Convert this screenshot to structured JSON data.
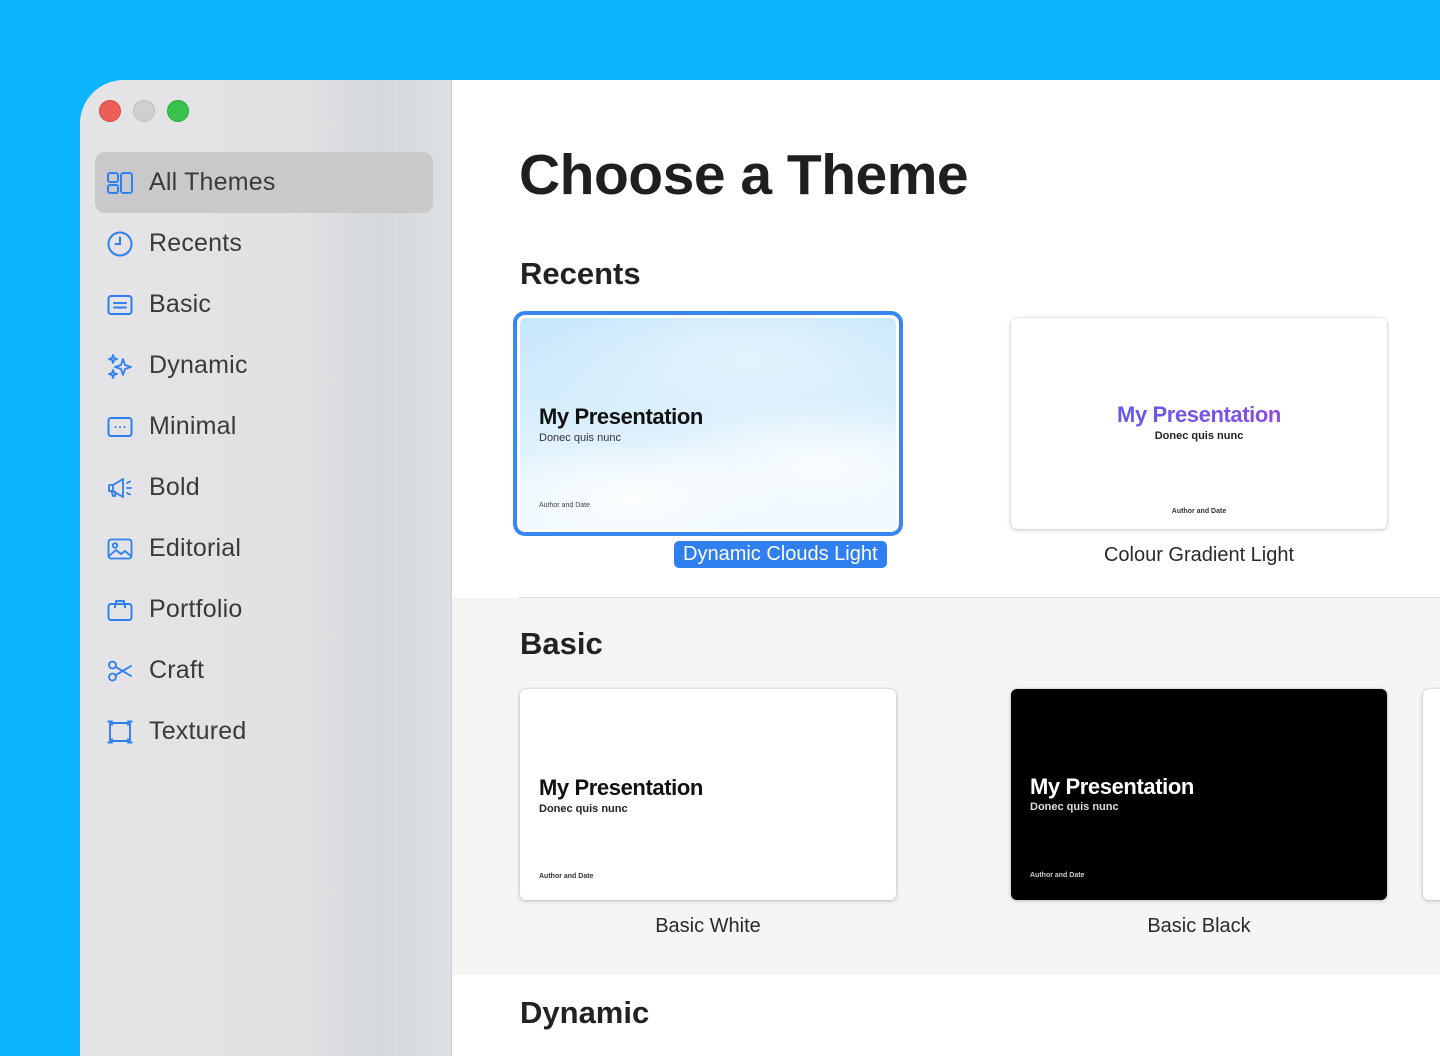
{
  "sidebar": {
    "items": [
      {
        "label": "All Themes",
        "icon": "all-themes-icon",
        "selected": true
      },
      {
        "label": "Recents",
        "icon": "clock-icon"
      },
      {
        "label": "Basic",
        "icon": "basic-icon"
      },
      {
        "label": "Dynamic",
        "icon": "sparkles-icon"
      },
      {
        "label": "Minimal",
        "icon": "minimal-icon"
      },
      {
        "label": "Bold",
        "icon": "megaphone-icon"
      },
      {
        "label": "Editorial",
        "icon": "photo-icon"
      },
      {
        "label": "Portfolio",
        "icon": "briefcase-icon"
      },
      {
        "label": "Craft",
        "icon": "scissors-icon"
      },
      {
        "label": "Textured",
        "icon": "textured-frame-icon"
      }
    ]
  },
  "main": {
    "title": "Choose a Theme",
    "sections": {
      "recents": "Recents",
      "basic": "Basic",
      "dynamic": "Dynamic"
    },
    "slide": {
      "title": "My Presentation",
      "subtitle": "Donec quis nunc",
      "author": "Author and Date"
    },
    "themes": {
      "dynamic_clouds_light": "Dynamic Clouds Light",
      "colour_gradient_light": "Colour Gradient Light",
      "basic_white": "Basic White",
      "basic_black": "Basic Black"
    }
  },
  "colors": {
    "desktop": "#0ab4ff",
    "accent": "#2f7ff0",
    "sidebar_icon": "#2f7ff0"
  }
}
